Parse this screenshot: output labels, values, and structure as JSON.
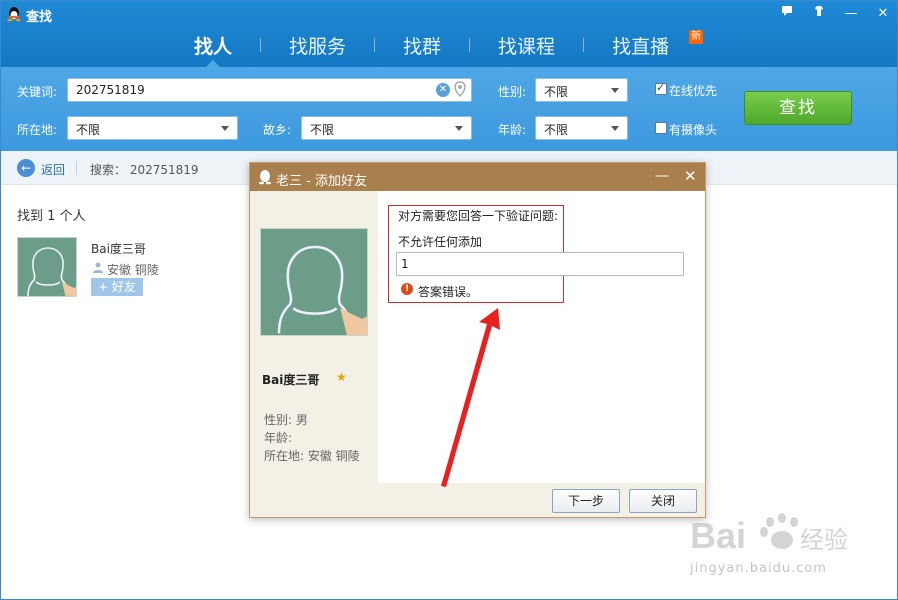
{
  "app": {
    "title": "查找"
  },
  "window_buttons": [
    "feedback-icon",
    "skin-icon",
    "minimize-icon",
    "close-icon"
  ],
  "tabs": [
    {
      "label": "找人",
      "active": true
    },
    {
      "label": "找服务"
    },
    {
      "label": "找群"
    },
    {
      "label": "找课程"
    },
    {
      "label": "找直播",
      "badge": "new"
    }
  ],
  "search": {
    "keyword_label": "关键词:",
    "keyword_value": "202751819",
    "gender_label": "性别:",
    "gender_value": "不限",
    "location_label": "所在地:",
    "location_value": "不限",
    "hometown_label": "故乡:",
    "hometown_value": "不限",
    "age_label": "年龄:",
    "age_value": "不限",
    "online_first_label": "在线优先",
    "online_first_checked": true,
    "has_camera_label": "有摄像头",
    "has_camera_checked": false,
    "find_button": "查找"
  },
  "breadcrumb": {
    "back_label": "返回",
    "search_text": "搜索： 202751819"
  },
  "results": {
    "summary": "找到 1 个人",
    "items": [
      {
        "name": "Bai度三哥",
        "location": "安徽 铜陵",
        "add_label": "+ 好友"
      }
    ]
  },
  "dialog": {
    "title": "老三 - 添加好友",
    "profile": {
      "name": "Bai度三哥",
      "gender": "性别: 男",
      "age": "年龄:",
      "location": "所在地: 安徽 铜陵"
    },
    "question_intro": "对方需要您回答一下验证问题:",
    "question": "不允许任何添加",
    "answer_value": "1",
    "error_text": "答案错误。",
    "next_button": "下一步",
    "close_button": "关闭"
  },
  "watermark": {
    "brand": "Bai",
    "brand2": "du",
    "brand_cn": "经验",
    "site": "jingyan.baidu.com"
  },
  "colors": {
    "header_blue": "#1f8ad6",
    "search_blue": "#4ea7e6",
    "find_green": "#5cb534",
    "dialog_brown": "#a9804d",
    "error_red": "#d42b2b"
  }
}
